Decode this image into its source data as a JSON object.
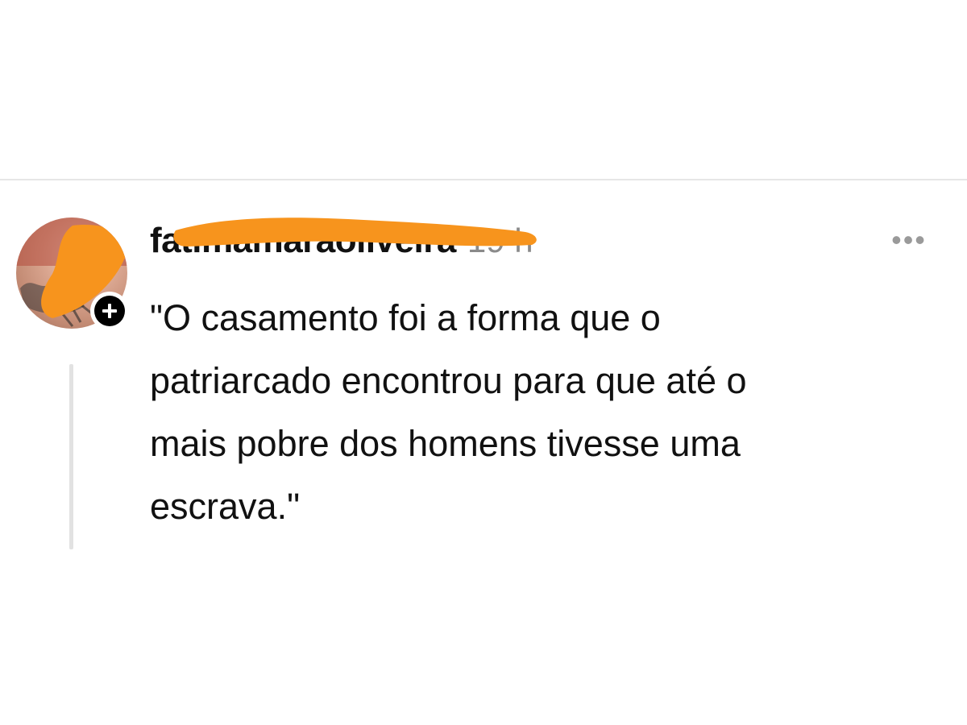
{
  "post": {
    "author": {
      "username": "fatimamaraoliveira",
      "username_redacted": true,
      "avatar_icon": "avatar-photo",
      "follow_icon": "plus-icon"
    },
    "timestamp": "19 h",
    "more_icon": "ellipsis-icon",
    "more_label": "•••",
    "text": "\"O casamento foi a forma que o\npatriarcado encontrou para que até o\nmais pobre dos homens tivesse uma\nescrava.\""
  },
  "colors": {
    "redaction": "#f7941d",
    "text": "#111111",
    "muted": "#8a8a8a",
    "divider": "#e6e6e6",
    "thread_line": "#e2e2e2"
  }
}
